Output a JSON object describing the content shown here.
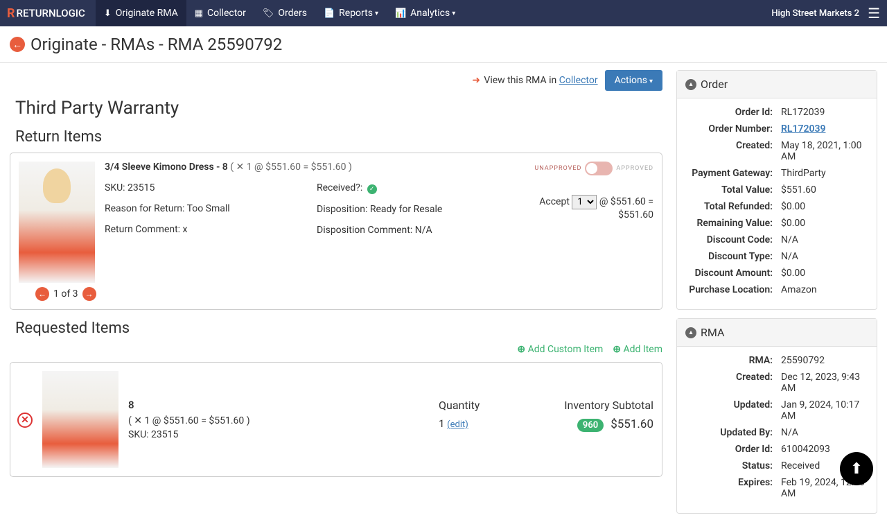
{
  "nav": {
    "logo": "RETURNLOGIC",
    "items": [
      "Originate RMA",
      "Collector",
      "Orders",
      "Reports",
      "Analytics"
    ],
    "account": "High Street Markets 2"
  },
  "breadcrumb": "Originate - RMAs - RMA 25590792",
  "top_actions": {
    "view_text": "View this RMA in ",
    "collector": "Collector",
    "actions": "Actions"
  },
  "section_title": "Third Party Warranty",
  "return_items_title": "Return Items",
  "return_item": {
    "name": "3/4 Sleeve Kimono Dress - 8",
    "price_text": " ( ✕ 1 @ $551.60 = $551.60 )",
    "sku_label": "SKU: ",
    "sku": "23515",
    "reason_label": "Reason for Return: ",
    "reason": "Too Small",
    "comment_label": "Return Comment: ",
    "comment": "x",
    "received_label": "Received?: ",
    "disp_label": "Disposition: ",
    "disp": "Ready for Resale",
    "disp_comment_label": "Disposition Comment: ",
    "disp_comment": "N/A",
    "unapproved": "UNAPPROVED",
    "approved": "APPROVED",
    "accept_label": "Accept",
    "accept_suffix": " @ $551.60 = $551.60",
    "pager": "1 of 3"
  },
  "requested_title": "Requested Items",
  "add_custom": "Add Custom Item",
  "add_item": "Add Item",
  "requested": {
    "name": "8",
    "price_text": "( ✕ 1 @ $551.60 = $551.60 )",
    "sku_label": "SKU: ",
    "sku": "23515",
    "qty_hdr": "Quantity",
    "qty": "1",
    "edit": "(edit)",
    "inv_hdr": "Inventory Subtotal",
    "badge": "960",
    "subtotal": "$551.60"
  },
  "order_panel": {
    "title": "Order",
    "rows": [
      {
        "k": "Order Id:",
        "v": "RL172039"
      },
      {
        "k": "Order Number:",
        "v": "RL172039",
        "link": true
      },
      {
        "k": "Created:",
        "v": "May 18, 2021, 1:00 AM"
      },
      {
        "k": "Payment Gateway:",
        "v": "ThirdParty"
      },
      {
        "k": "Total Value:",
        "v": "$551.60"
      },
      {
        "k": "Total Refunded:",
        "v": "$0.00"
      },
      {
        "k": "Remaining Value:",
        "v": "$0.00"
      },
      {
        "k": "Discount Code:",
        "v": "N/A"
      },
      {
        "k": "Discount Type:",
        "v": "N/A"
      },
      {
        "k": "Discount Amount:",
        "v": "$0.00"
      },
      {
        "k": "Purchase Location:",
        "v": "Amazon"
      }
    ]
  },
  "rma_panel": {
    "title": "RMA",
    "rows": [
      {
        "k": "RMA:",
        "v": "25590792"
      },
      {
        "k": "Created:",
        "v": "Dec 12, 2023, 9:43 AM"
      },
      {
        "k": "Updated:",
        "v": "Jan 9, 2024, 10:17 AM"
      },
      {
        "k": "Updated By:",
        "v": "N/A"
      },
      {
        "k": "Order Id:",
        "v": "610042093"
      },
      {
        "k": "Status:",
        "v": "Received"
      },
      {
        "k": "Expires:",
        "v": "Feb 19, 2024, 12:00 AM"
      }
    ]
  }
}
